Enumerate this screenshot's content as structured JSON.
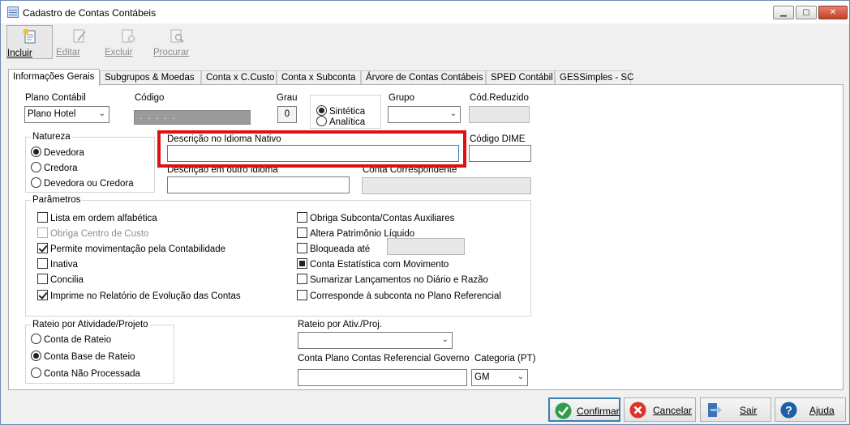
{
  "window": {
    "title": "Cadastro de Contas Contábeis",
    "minimize": "▁",
    "maximize": "▢",
    "close": "✕"
  },
  "toolbar": {
    "incluir": "Incluir",
    "editar": "Editar",
    "excluir": "Excluir",
    "procurar": "Procurar"
  },
  "tabs": [
    "Informações Gerais",
    "Subgrupos & Moedas",
    "Conta x C.Custo",
    "Conta x Subconta",
    "Árvore de Contas Contábeis",
    "SPED Contábil",
    "GESSimples - SC"
  ],
  "form": {
    "plano_contabil_label": "Plano Contábil",
    "plano_contabil_value": "Plano Hotel",
    "codigo_label": "Código",
    "codigo_value": ". . . . .",
    "grau_label": "Grau",
    "grau_value": "0",
    "sintetica_label": "Sintética",
    "analitica_label": "Analítica",
    "grupo_label": "Grupo",
    "grupo_value": "",
    "cod_reduzido_label": "Cód.Reduzido",
    "cod_reduzido_value": "",
    "descricao_nativo_label": "Descrição no Idioma Nativo",
    "descricao_nativo_value": "",
    "codigo_dime_label": "Código DIME",
    "codigo_dime_value": "",
    "descricao_outro_label": "Descrição em outro idioma",
    "descricao_outro_value": "",
    "conta_correspondente_label": "Conta Correspondente",
    "conta_correspondente_value": ""
  },
  "natureza": {
    "legend": "Natureza",
    "options": [
      "Devedora",
      "Credora",
      "Devedora ou Credora"
    ],
    "selected": "Devedora"
  },
  "parametros": {
    "legend": "Parâmetros",
    "left": [
      {
        "label": "Lista em ordem alfabética",
        "checked": false,
        "disabled": false
      },
      {
        "label": "Obriga Centro de Custo",
        "checked": false,
        "disabled": true
      },
      {
        "label": "Permite movimentação pela Contabilidade",
        "checked": true,
        "disabled": false
      },
      {
        "label": "Inativa",
        "checked": false,
        "disabled": false
      },
      {
        "label": "Concilia",
        "checked": false,
        "disabled": false
      },
      {
        "label": "Imprime no Relatório de Evolução das Contas",
        "checked": true,
        "disabled": false
      }
    ],
    "right": [
      {
        "label": "Obriga Subconta/Contas Auxiliares",
        "checked": false
      },
      {
        "label": "Altera Patrimônio Líquido",
        "checked": false
      },
      {
        "label": "Bloqueada até",
        "checked": false
      },
      {
        "label": "Conta Estatística com Movimento",
        "checked": "indeterminate"
      },
      {
        "label": "Sumarizar Lançamentos no Diário e Razão",
        "checked": false
      },
      {
        "label": "Corresponde à subconta no Plano Referencial",
        "checked": false
      }
    ],
    "bloqueada_value": ""
  },
  "rateio": {
    "legend": "Rateio por Atividade/Projeto",
    "options": [
      "Conta de Rateio",
      "Conta Base de Rateio",
      "Conta Não Processada"
    ],
    "selected": "Conta Base de Rateio"
  },
  "rateio_ativ": {
    "label": "Rateio por Ativ./Proj.",
    "value": ""
  },
  "conta_referencial": {
    "label": "Conta Plano Contas Referencial Governo",
    "value": ""
  },
  "categoria": {
    "label": "Categoria (PT)",
    "value": "GM"
  },
  "buttons": {
    "confirmar": "Confirmar",
    "cancelar": "Cancelar",
    "sair": "Sair",
    "ajuda": "Ajuda"
  },
  "colors": {
    "highlight": "#e01010",
    "confirm_border": "#3c7fb1",
    "panel_border": "#adadad"
  }
}
